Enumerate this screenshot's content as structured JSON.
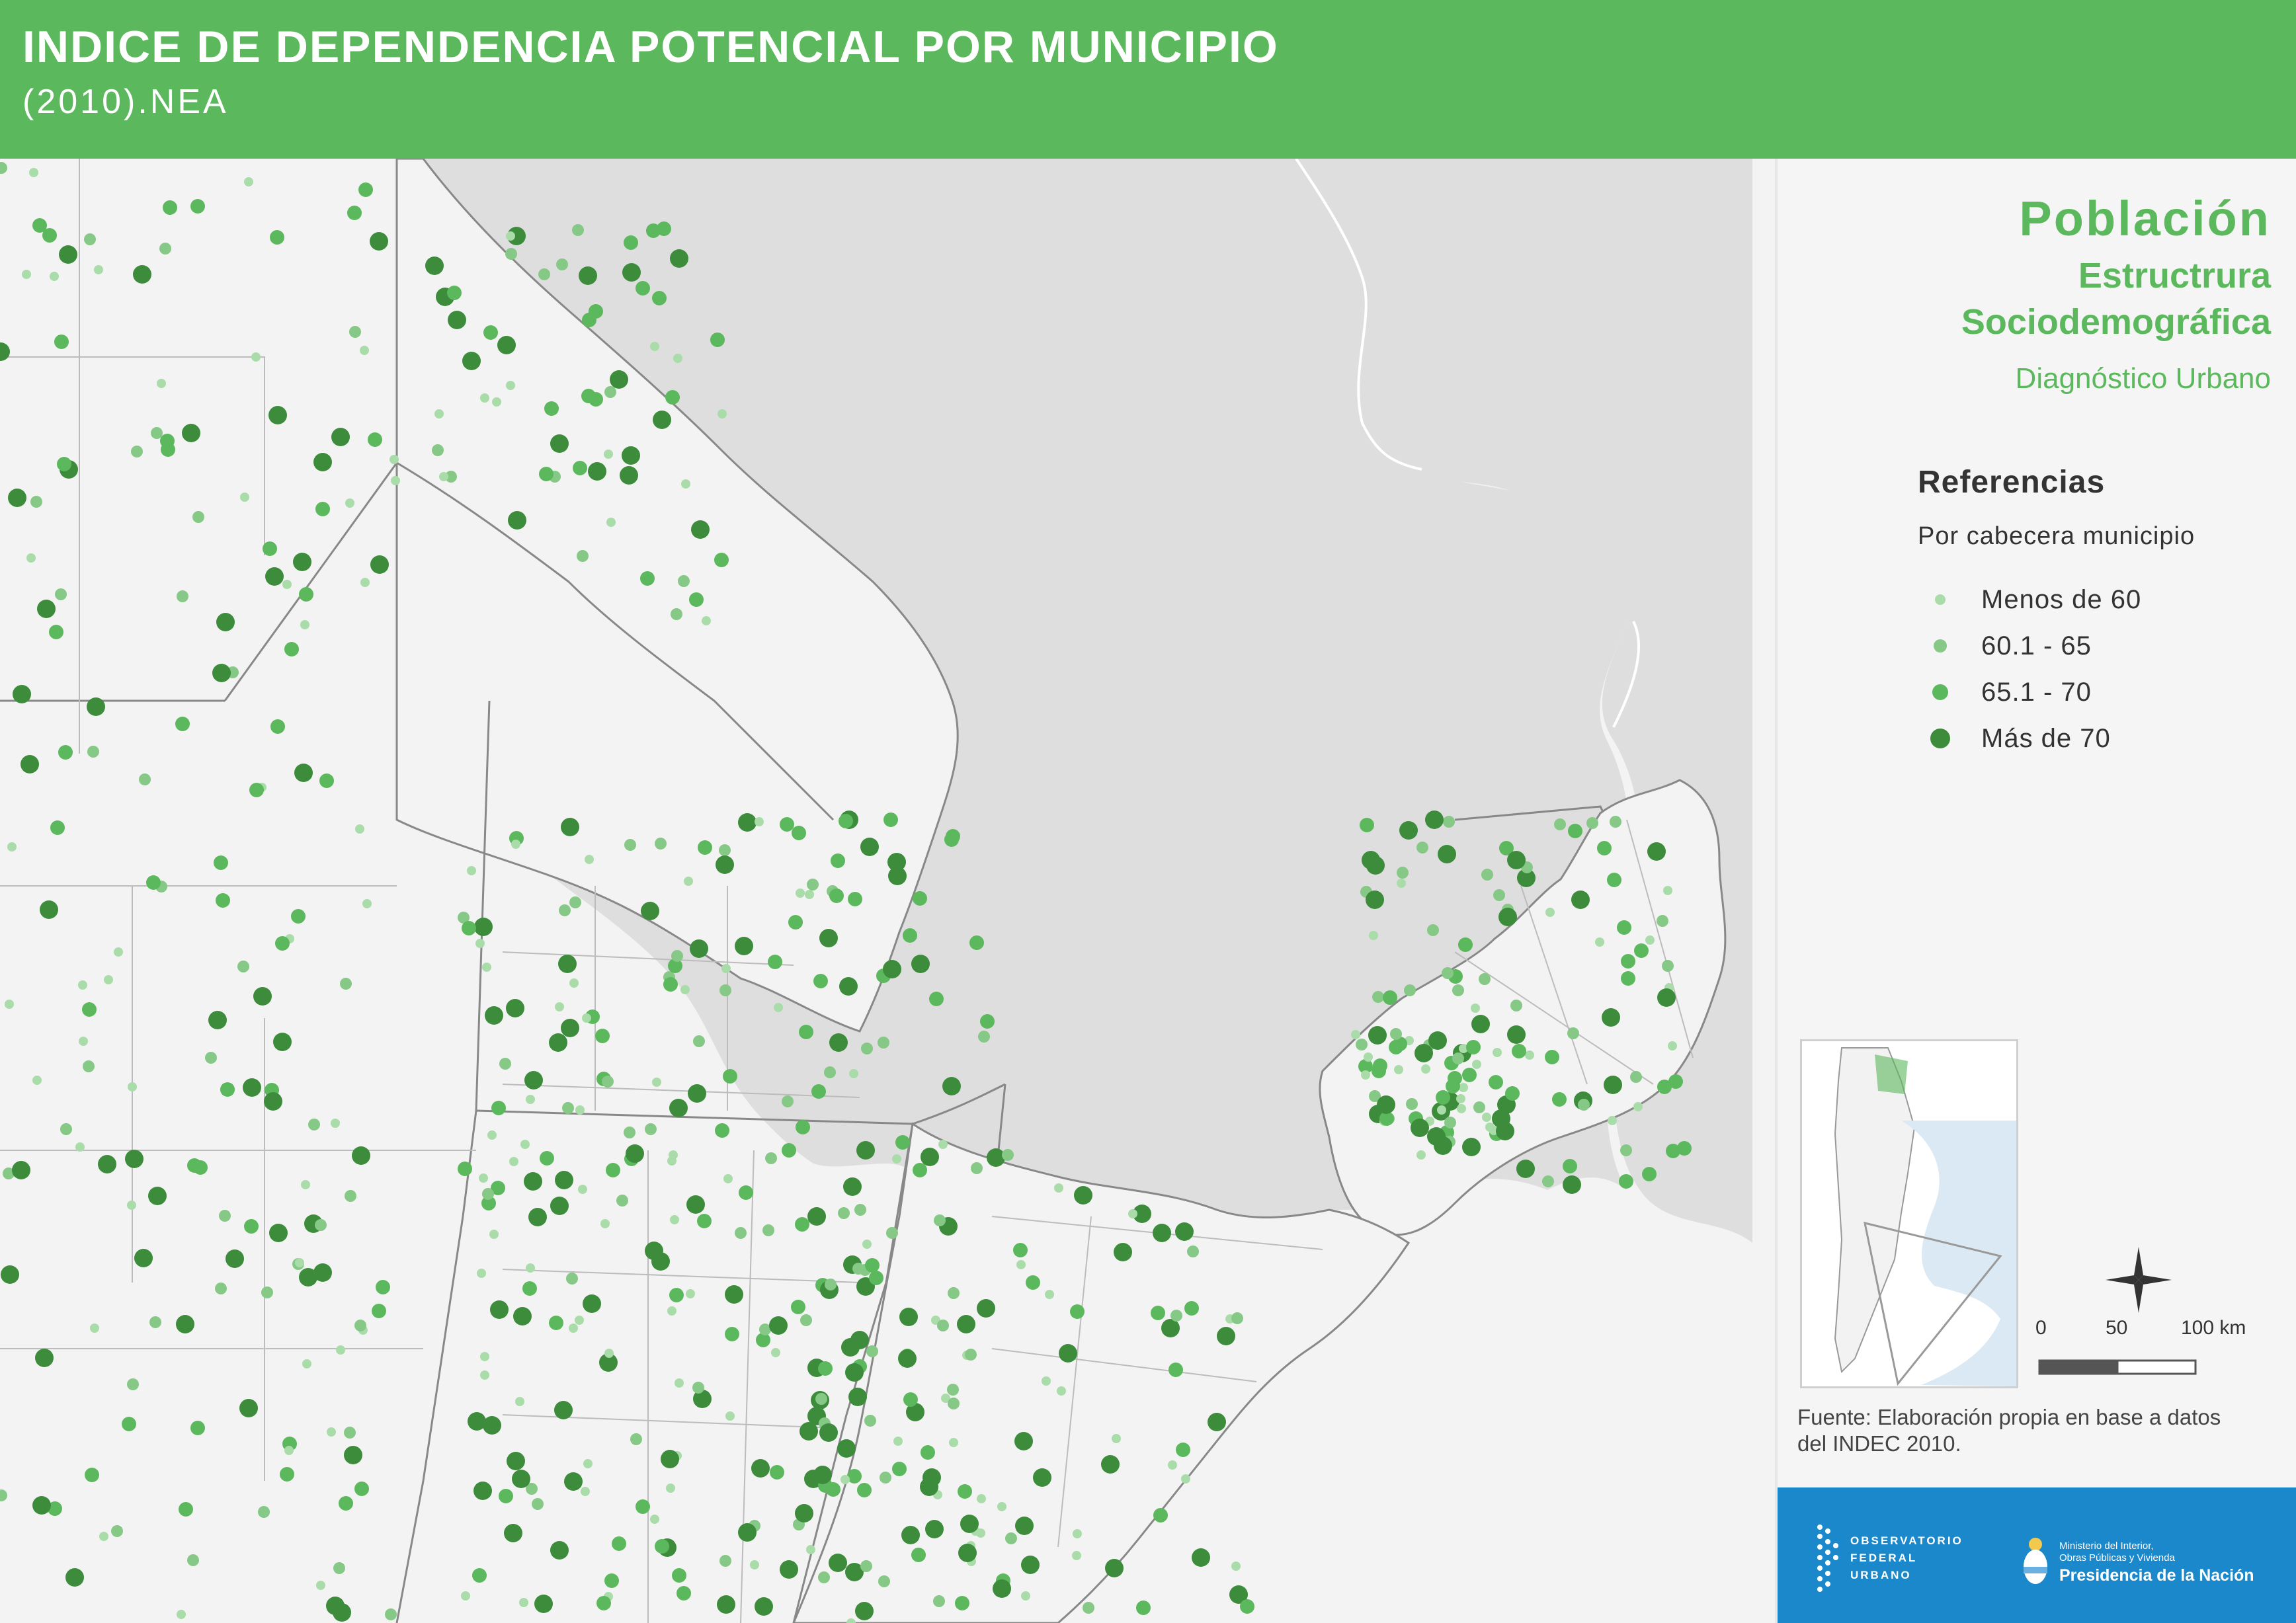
{
  "header": {
    "title": "INDICE DE DEPENDENCIA POTENCIAL POR MUNICIPIO",
    "subtitle": "(2010).NEA"
  },
  "panel": {
    "title": "Población",
    "subtitle_line1": "Estructrura",
    "subtitle_line2": "Sociodemográfica",
    "subtitle_line3": "Diagnóstico Urbano"
  },
  "legend": {
    "title": "Referencias",
    "subtitle": "Por cabecera municipio",
    "items": [
      {
        "label": "Menos de 60",
        "color": "#a9dca9"
      },
      {
        "label": "60.1 - 65",
        "color": "#86c886"
      },
      {
        "label": "65.1 - 70",
        "color": "#5cb85c"
      },
      {
        "label": "Más de 70",
        "color": "#3c8c3c"
      }
    ]
  },
  "scale": {
    "labels": [
      "0",
      "50",
      "100 km"
    ]
  },
  "source": {
    "line1": "Fuente: Elaboración propia en base a datos",
    "line2": "del INDEC  2010."
  },
  "footer": {
    "ofu_line1": "OBSERVATORIO",
    "ofu_line2": "FEDERAL",
    "ofu_line3": "URBANO",
    "ministry_line1": "Ministerio del Interior,",
    "ministry_line2": "Obras Públicas y Vivienda",
    "ministry_line3": "Presidencia de la Nación"
  },
  "colors": {
    "brand_green": "#5cb85c",
    "footer_blue": "#1b88cc",
    "water": "#dedede",
    "land": "#f3f3f3"
  }
}
